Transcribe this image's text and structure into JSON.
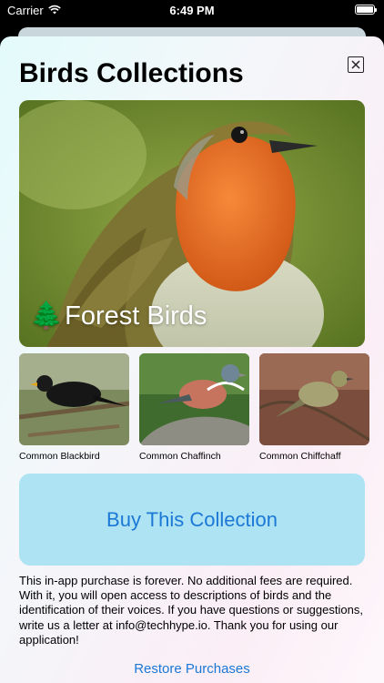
{
  "status_bar": {
    "carrier": "Carrier",
    "time": "6:49 PM",
    "wifi_icon": "wifi-icon",
    "battery_icon": "battery-icon",
    "battery_level": 1.0
  },
  "sheet": {
    "title": "Birds Collections",
    "close_icon": "close-icon"
  },
  "hero": {
    "emoji": "🌲",
    "label": "Forest Birds"
  },
  "thumbnails": [
    {
      "caption": "Common Blackbird"
    },
    {
      "caption": "Common Chaffinch"
    },
    {
      "caption": "Common Chiffchaff"
    }
  ],
  "buy_label": "Buy This Collection",
  "description": "This in-app purchase is forever. No additional fees are required. With it, you will open access to descriptions of birds and the identification of their voices. If you have questions or suggestions, write us a letter at info@techhype.io. Thank you for using our application!",
  "restore_label": "Restore Purchases",
  "colors": {
    "accent": "#1b78d6",
    "buy_button_bg": "#aee3f3"
  }
}
